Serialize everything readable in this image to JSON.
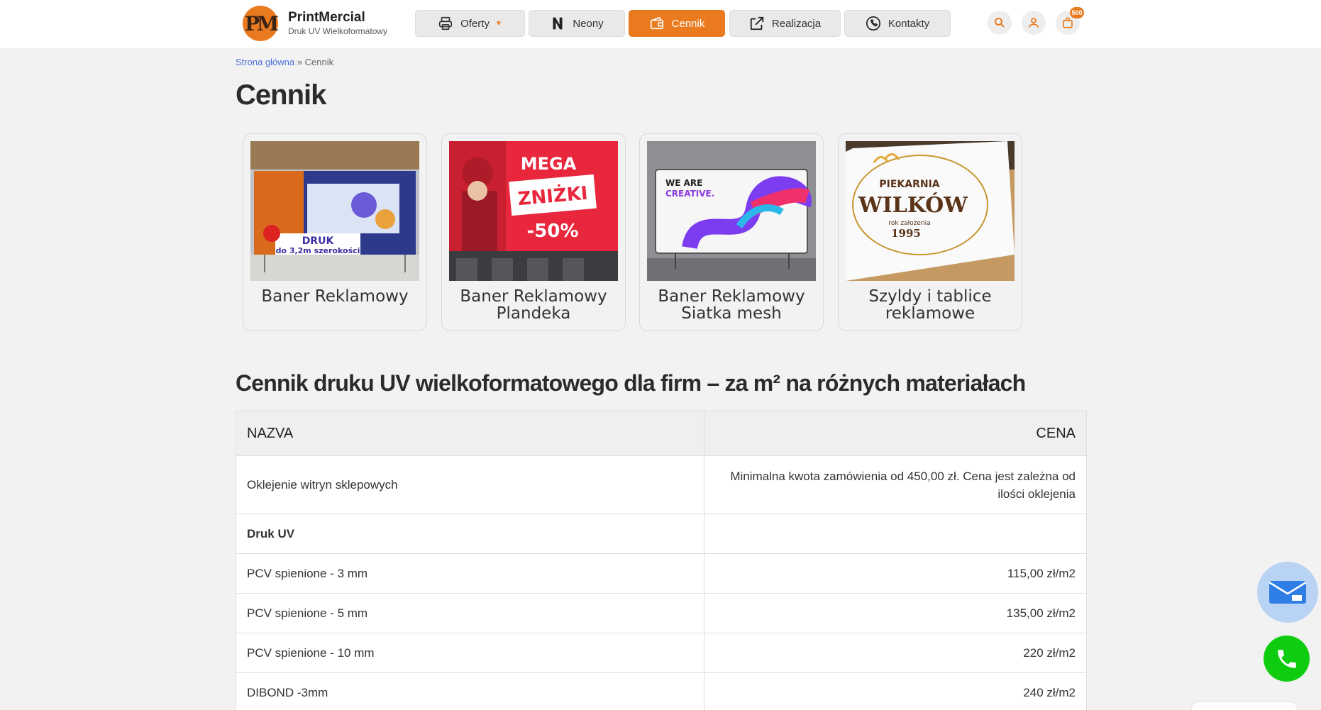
{
  "header": {
    "logo_text": "PM",
    "brand_name": "PrintMercial",
    "brand_sub": "Druk UV Wielkoformatowy",
    "nav": [
      {
        "label": "Oferty",
        "icon": "printer-icon",
        "has_dropdown": true
      },
      {
        "label": "Neony",
        "icon": "neon-n-icon"
      },
      {
        "label": "Cennik",
        "icon": "wallet-icon",
        "active": true
      },
      {
        "label": "Realizacja",
        "icon": "external-link-icon"
      },
      {
        "label": "Kontakty",
        "icon": "phone-icon"
      }
    ],
    "cart_badge": "500"
  },
  "breadcrumb": {
    "home": "Strona główna",
    "separator": "»",
    "current": "Cennik"
  },
  "page_title": "Cennik",
  "cards": [
    {
      "label_line1": "Baner Reklamowy",
      "label_line2": "",
      "image_text_1": "DRUK",
      "image_text_2": "do 3,2m szerokości"
    },
    {
      "label_line1": "Baner Reklamowy",
      "label_line2": "Plandeka",
      "image_text_1": "MEGA",
      "image_text_2": "ZNIŻKI",
      "image_text_3": "-50%"
    },
    {
      "label_line1": "Baner Reklamowy",
      "label_line2": "Siatka mesh",
      "image_text_1": "WE ARE",
      "image_text_2": "CREATIVE."
    },
    {
      "label_line1": "Szyldy i tablice",
      "label_line2": "reklamowe",
      "image_text_1": "PIEKARNIA",
      "image_text_2": "WILKÓW",
      "image_text_3": "rok założenia",
      "image_text_4": "1995"
    }
  ],
  "section_title": "Cennik druku UV wielkoformatowego dla firm – za m² na różnych materiałach",
  "table": {
    "headers": [
      "NAZVA",
      "CENA"
    ],
    "rows": [
      {
        "name": "Oklejenie witryn sklepowych",
        "price": "Minimalna kwota zamówienia od 450,00 zł. Cena jest zależna od ilości oklejenia"
      },
      {
        "name": "Druk UV",
        "price": "",
        "bold": true
      },
      {
        "name": "PCV spienione - 3 mm",
        "price": "115,00 zł/m2"
      },
      {
        "name": "PCV spienione - 5 mm",
        "price": "135,00 zł/m2"
      },
      {
        "name": "PCV spienione - 10 mm",
        "price": "220 zł/m2"
      },
      {
        "name": "DIBOND -3mm",
        "price": "240 zł/m2"
      }
    ]
  },
  "colors": {
    "accent": "#ea7a1f",
    "link": "#4a6fd8",
    "phone_fab": "#10cc10",
    "mail_fab": "#b9d3f4"
  }
}
